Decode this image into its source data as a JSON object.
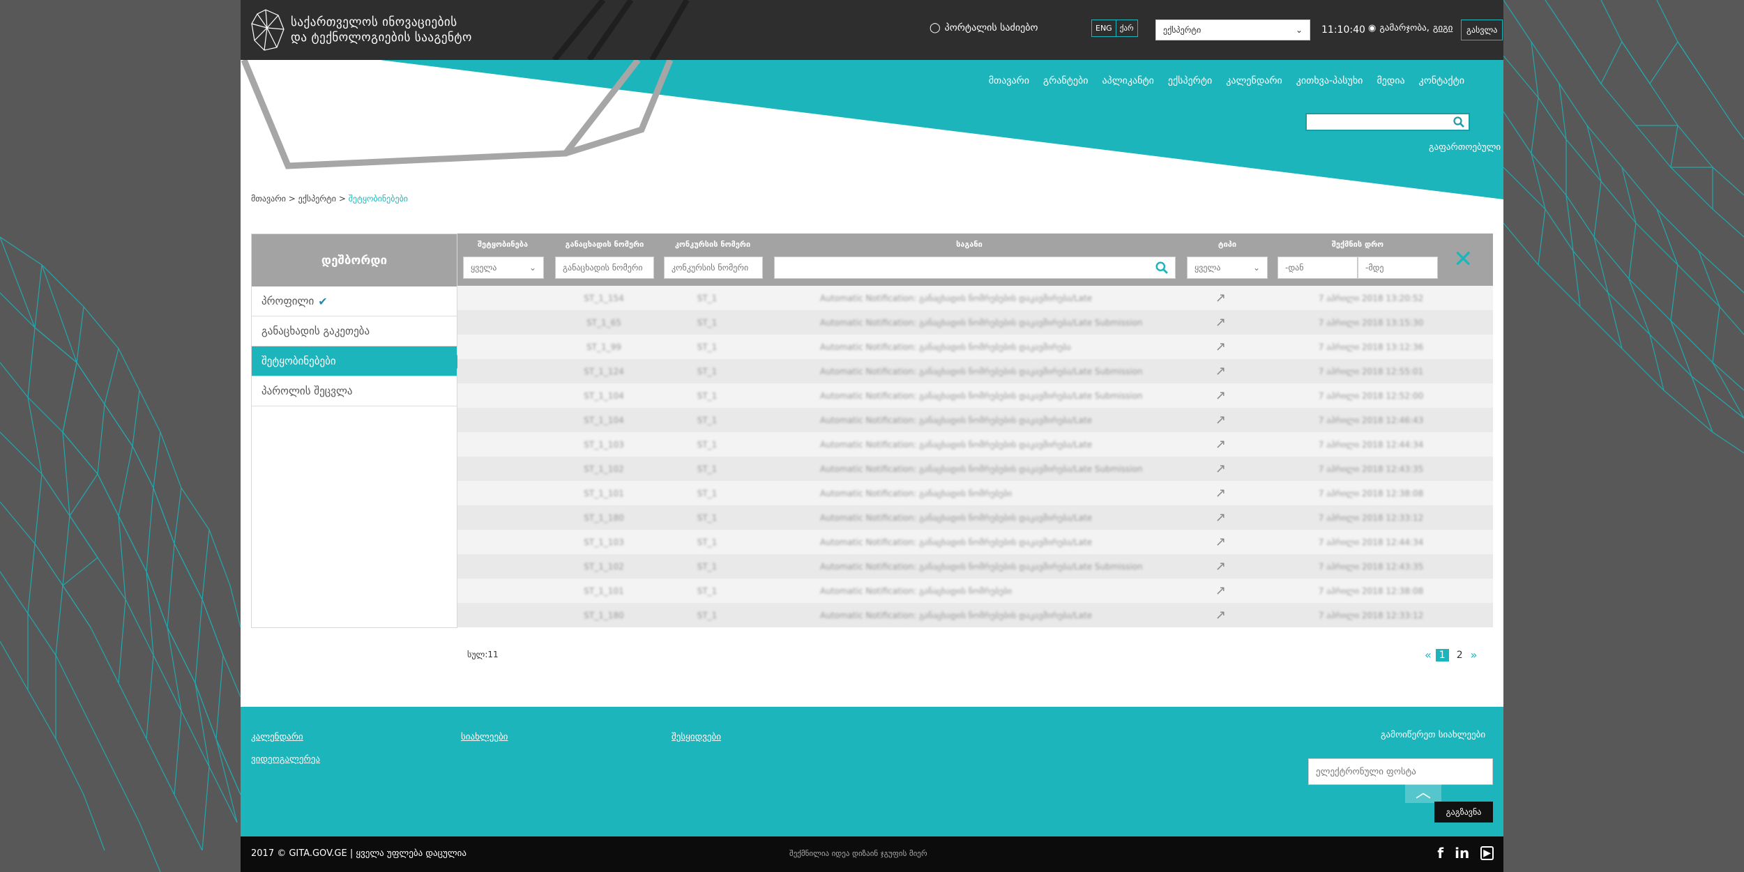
{
  "colors": {
    "accent": "#1cb5bb",
    "header": "#2e2e2e",
    "grey": "#a3a3a3"
  },
  "header": {
    "logo_line1": "საქართველოს ინოვაციების",
    "logo_line2": "და ტექნოლოგიების სააგენტო",
    "portal_search": "პორტალის საძიებო",
    "lang": [
      "ENG",
      "ქარ"
    ],
    "role": "ექსპერტი",
    "clock": "11:10:40",
    "greeting": "გამარჯობა,",
    "username": "გიგი",
    "logout": "გასვლა"
  },
  "nav": [
    "მთავარი",
    "გრანტები",
    "აპლიკანტი",
    "ექსპერტი",
    "კალენდარი",
    "კითხვა-პასუხი",
    "მედია",
    "კონტაქტი"
  ],
  "search": {
    "advanced": "გაფართოებული"
  },
  "breadcrumb": {
    "home": "მთავარი",
    "sep": " > ",
    "expert": "ექსპერტი",
    "current": "შეტყობინებები"
  },
  "sidebar": {
    "title": "დეშბორდი",
    "items": [
      "პროფილი",
      "განაცხადის გაკეთება",
      "შეტყობინებები",
      "პაროლის შეცვლა"
    ]
  },
  "table": {
    "headers": {
      "status": "შეტყობინება",
      "app_num": "განაცხადის ნომერი",
      "comp_num": "კონკურსის ნომერი",
      "subject": "საგანი",
      "type": "ტიპი",
      "created": "შექმნის დრო"
    },
    "filters": {
      "status": "ყველა",
      "app_num_ph": "განაცხადის ნომერი",
      "comp_num_ph": "კონკურსის ნომერი",
      "type": "ყველა",
      "from_ph": "-დან",
      "to_ph": "-მდე"
    },
    "rows": [
      {
        "num": "ST_1_154",
        "comp": "ST_1",
        "subject": "Automatic Notification: განაცხადის ნომრებების დაკავშირება/Late",
        "date": "7 აპრილი 2018 13:20:52"
      },
      {
        "num": "ST_1_65",
        "comp": "ST_1",
        "subject": "Automatic Notification: განაცხადის ნომრებების დაკავშირება/Late Submission",
        "date": "7 აპრილი 2018 13:15:30"
      },
      {
        "num": "ST_1_99",
        "comp": "ST_1",
        "subject": "Automatic Notification: განაცხადის ნომრებების დაკავშირება",
        "date": "7 აპრილი 2018 13:12:36"
      },
      {
        "num": "ST_1_124",
        "comp": "ST_1",
        "subject": "Automatic Notification: განაცხადის ნომრებების დაკავშირება/Late Submission",
        "date": "7 აპრილი 2018 12:55:01"
      },
      {
        "num": "ST_1_104",
        "comp": "ST_1",
        "subject": "Automatic Notification: განაცხადის ნომრებების დაკავშირება/Late Submission",
        "date": "7 აპრილი 2018 12:52:00"
      },
      {
        "num": "ST_1_104",
        "comp": "ST_1",
        "subject": "Automatic Notification: განაცხადის ნომრებების დაკავშირება/Late",
        "date": "7 აპრილი 2018 12:46:43"
      },
      {
        "num": "ST_1_103",
        "comp": "ST_1",
        "subject": "Automatic Notification: განაცხადის ნომრებების დაკავშირება/Late",
        "date": "7 აპრილი 2018 12:44:34"
      },
      {
        "num": "ST_1_102",
        "comp": "ST_1",
        "subject": "Automatic Notification: განაცხადის ნომრებების დაკავშირება/Late Submission",
        "date": "7 აპრილი 2018 12:43:35"
      },
      {
        "num": "ST_1_101",
        "comp": "ST_1",
        "subject": "Automatic Notification: განაცხადის ნომრებები",
        "date": "7 აპრილი 2018 12:38:08"
      },
      {
        "num": "ST_1_180",
        "comp": "ST_1",
        "subject": "Automatic Notification: განაცხადის ნომრებების დაკავშირება/Late",
        "date": "7 აპრილი 2018 12:33:12"
      },
      {
        "num": "ST_1_103",
        "comp": "ST_1",
        "subject": "Automatic Notification: განაცხადის ნომრებების დაკავშირება/Late",
        "date": "7 აპრილი 2018 12:44:34"
      },
      {
        "num": "ST_1_102",
        "comp": "ST_1",
        "subject": "Automatic Notification: განაცხადის ნომრებების დაკავშირება/Late Submission",
        "date": "7 აპრილი 2018 12:43:35"
      },
      {
        "num": "ST_1_101",
        "comp": "ST_1",
        "subject": "Automatic Notification: განაცხადის ნომრებები",
        "date": "7 აპრილი 2018 12:38:08"
      },
      {
        "num": "ST_1_180",
        "comp": "ST_1",
        "subject": "Automatic Notification: განაცხადის ნომრებების დაკავშირება/Late",
        "date": "7 აპრილი 2018 12:33:12"
      }
    ],
    "type_icon": "arrow-up-right-icon",
    "total": "სულ:11",
    "pages": [
      "1",
      "2"
    ],
    "current_page": "1",
    "prev": "«",
    "next": "»"
  },
  "footer": {
    "links": [
      "კალენდარი",
      "სიახლეები",
      "შესყიდვები",
      "ვიდეოგალერეა"
    ],
    "newsletter_title": "გამოიწერეთ სიახლეები",
    "email_placeholder": "ელექტრონული ფოსტა",
    "subscribe": "გაგზავნა",
    "copyright": "2017 © GITA.GOV.GE | ყველა უფლება დაცულია",
    "credits": "შექმნილია იდეა დიზაინ ჯგუფის მიერ"
  }
}
